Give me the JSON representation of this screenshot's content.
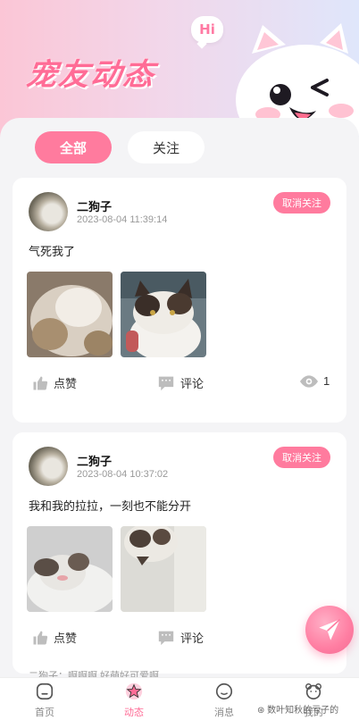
{
  "header": {
    "title": "宠友动态",
    "bubble": "Hi"
  },
  "tabs": [
    {
      "label": "全部",
      "active": true
    },
    {
      "label": "关注",
      "active": false
    }
  ],
  "posts": [
    {
      "username": "二狗子",
      "time": "2023-08-04 11:39:14",
      "follow_button": "取消关注",
      "content": "气死我了",
      "like_label": "点赞",
      "comment_label": "评论",
      "views": "1"
    },
    {
      "username": "二狗子",
      "time": "2023-08-04 10:37:02",
      "follow_button": "取消关注",
      "content": "我和我的拉拉，一刻也不能分开",
      "like_label": "点赞",
      "comment_label": "评论",
      "comment_preview": "二狗子：啊啊啊 好萌好可爱啊"
    }
  ],
  "tabbar": [
    {
      "label": "首页",
      "icon": "home-icon"
    },
    {
      "label": "动态",
      "icon": "flower-icon",
      "active": true
    },
    {
      "label": "消息",
      "icon": "chat-face-icon"
    },
    {
      "label": "我的",
      "icon": "bear-icon"
    }
  ],
  "watermark": "⊛ 数叶知秋的亏子的",
  "colors": {
    "accent": "#ff7b9e",
    "header_start": "#fbc6d6",
    "header_end": "#dfe6fb"
  }
}
